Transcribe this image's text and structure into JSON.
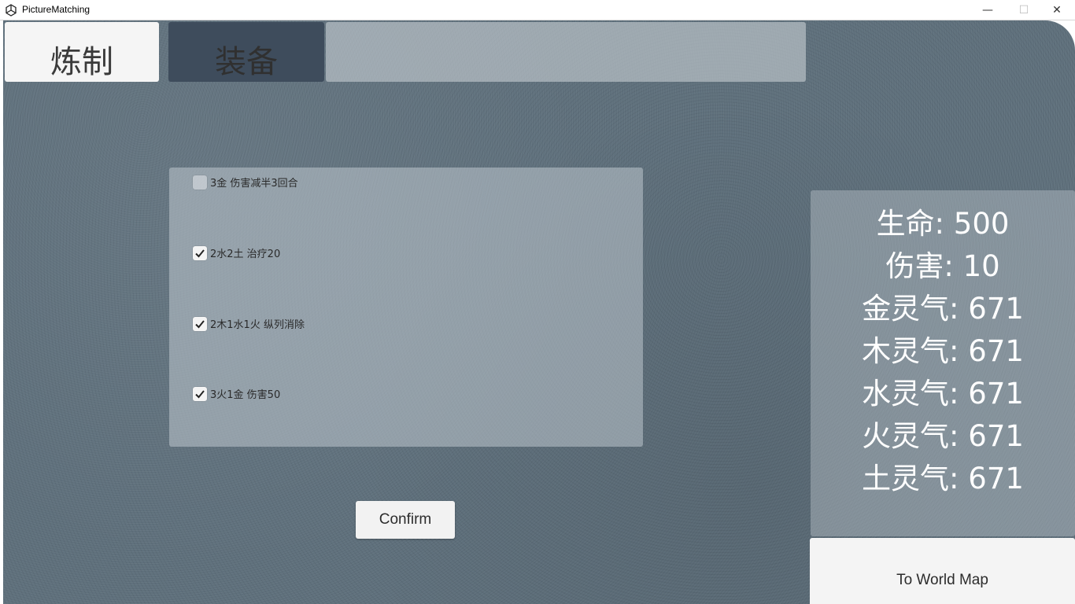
{
  "window": {
    "title": "PictureMatching",
    "minimize_glyph": "—",
    "maximize_glyph": "☐",
    "close_glyph": "✕"
  },
  "tabs": {
    "refine_label": "炼制",
    "equip_label": "装备"
  },
  "skills": [
    {
      "label": "3金 伤害减半3回合",
      "checked": false
    },
    {
      "label": "2水2土 治疗20",
      "checked": true
    },
    {
      "label": "2木1水1火 纵列消除",
      "checked": true
    },
    {
      "label": "3火1金 伤害50",
      "checked": true
    }
  ],
  "confirm_label": "Confirm",
  "stats": {
    "hp": "生命: 500",
    "damage": "伤害: 10",
    "metal": "金灵气: 671",
    "wood": "木灵气: 671",
    "water": "水灵气: 671",
    "fire": "火灵气: 671",
    "earth": "土灵气: 671"
  },
  "world_map_label": "To World Map",
  "colors": {
    "background": "#5f707c",
    "active_tab": "#f5f5f5",
    "inactive_tab": "#3e4c5c"
  }
}
